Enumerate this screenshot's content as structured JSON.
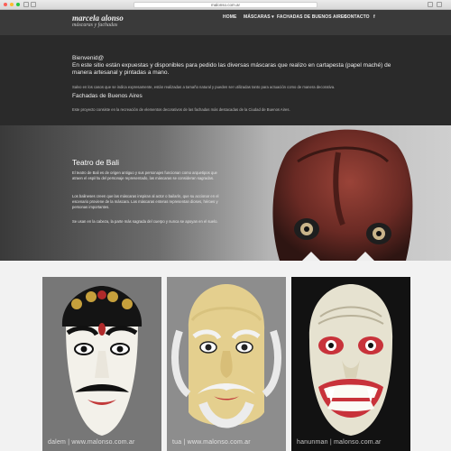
{
  "browser": {
    "url": "malonso.com.ar"
  },
  "header": {
    "logo_name": "marcela alonso",
    "logo_sub": "máscaras y fachadas",
    "nav": [
      {
        "label": "HOME"
      },
      {
        "label": "MÁSCARAS ▾"
      },
      {
        "label": "FACHADAS DE BUENOS AIRES"
      },
      {
        "label": "CONTACTO"
      },
      {
        "label": "f"
      }
    ]
  },
  "intro": {
    "greeting": "Bienvenid@",
    "lead": "En este sitio están expuestas y disponibles para pedido las diversas máscaras que realizo en cartapesta (papel maché) de manera artesanal y pintadas a mano.",
    "note": "Salvo en los casos que se indica expresamente, están realizadas a tamaño natural y pueden ser utilizadas tanto para actuación como de manera decorativa.",
    "fachadas_title": "Fachadas de Buenos Aires",
    "fachadas_text": "Este proyecto consiste en la recreación de elementos decorativos de las fachadas más destacadas de la Ciudad de Buenos Aires."
  },
  "teatro": {
    "title": "Teatro de Bali",
    "p1": "El teatro de Bali es de origen antiguo y sus personajes funcionan como arquetipos que atraen el espíritu del personaje representado, las máscaras se consideran sagradas.",
    "p2": "Los balineses creen que las máscaras inspiran al actor o bailarín, que su accionar en el escenario proviene de la máscara. Las máscaras enteras representan dioses, héroes y personas importantes.",
    "p3": "Se usan en la cabeza, la parte más sagrada del cuerpo y nunca se apoyan en el suelo."
  },
  "gallery": [
    {
      "caption": "dalem | www.malonso.com.ar",
      "bg": "#6b6b6b"
    },
    {
      "caption": "tua | www.malonso.com.ar",
      "bg": "#8a8a8a"
    },
    {
      "caption": "hanunman | malonso.com.ar",
      "bg": "#141414"
    }
  ]
}
